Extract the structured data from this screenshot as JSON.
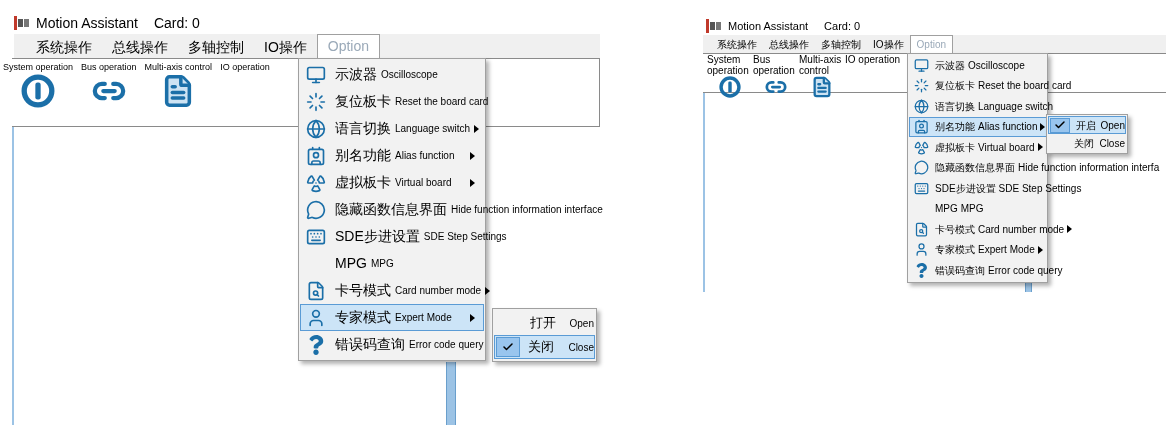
{
  "panels": [
    {
      "title": "Motion Assistant",
      "card": "Card: 0",
      "menubar": [
        {
          "label": "系统操作",
          "selected": false
        },
        {
          "label": "总线操作",
          "selected": false
        },
        {
          "label": "多轴控制",
          "selected": false
        },
        {
          "label": "IO操作",
          "selected": false
        },
        {
          "label": "Option",
          "selected": true
        }
      ],
      "toolbar": [
        {
          "label": "System operation"
        },
        {
          "label": "Bus operation"
        },
        {
          "label": "Multi-axis control"
        },
        {
          "label": "IO operation"
        }
      ],
      "menu": [
        {
          "zh": "示波器",
          "en": "Oscilloscope",
          "submenu": false,
          "selected": false
        },
        {
          "zh": "复位板卡",
          "en": "Reset the board card",
          "submenu": false,
          "selected": false
        },
        {
          "zh": "语言切换",
          "en": "Language switch",
          "submenu": true,
          "selected": false
        },
        {
          "zh": "别名功能",
          "en": "Alias function",
          "submenu": true,
          "selected": false
        },
        {
          "zh": "虚拟板卡",
          "en": "Virtual board",
          "submenu": true,
          "selected": false
        },
        {
          "zh": "隐藏函数信息界面",
          "en": "Hide function information interface",
          "submenu": false,
          "selected": false
        },
        {
          "zh": "SDE步进设置",
          "en": "SDE Step Settings",
          "submenu": false,
          "selected": false
        },
        {
          "zh": "MPG",
          "en": "MPG",
          "submenu": false,
          "selected": false
        },
        {
          "zh": "卡号模式",
          "en": "Card number mode",
          "submenu": true,
          "selected": false
        },
        {
          "zh": "专家模式",
          "en": "Expert Mode",
          "submenu": true,
          "selected": true
        },
        {
          "zh": "错误码查询",
          "en": "Error code query",
          "submenu": false,
          "selected": false
        }
      ],
      "submenu": [
        {
          "zh": "打开",
          "en": "Open",
          "checked": false,
          "selected": false
        },
        {
          "zh": "关闭",
          "en": "Close",
          "checked": true,
          "selected": true
        }
      ]
    },
    {
      "title": "Motion Assistant",
      "card": "Card: 0",
      "menubar": [
        {
          "label": "系统操作",
          "selected": false
        },
        {
          "label": "总线操作",
          "selected": false
        },
        {
          "label": "多轴控制",
          "selected": false
        },
        {
          "label": "IO操作",
          "selected": false
        },
        {
          "label": "Option",
          "selected": true
        }
      ],
      "toolbar": [
        {
          "label": "System operation"
        },
        {
          "label": "Bus operation"
        },
        {
          "label": "Multi-axis control"
        },
        {
          "label": "IO operation"
        }
      ],
      "menu": [
        {
          "zh": "示波器",
          "en": "Oscilloscope",
          "submenu": false,
          "selected": false
        },
        {
          "zh": "复位板卡",
          "en": "Reset the board card",
          "submenu": false,
          "selected": false
        },
        {
          "zh": "语言切换",
          "en": "Language switch",
          "submenu": false,
          "selected": false
        },
        {
          "zh": "别名功能",
          "en": "Alias function",
          "submenu": true,
          "selected": true
        },
        {
          "zh": "虚拟板卡",
          "en": "Virtual board",
          "submenu": true,
          "selected": false
        },
        {
          "zh": "隐藏函数信息界面",
          "en": "Hide function information interfa",
          "submenu": false,
          "selected": false
        },
        {
          "zh": "SDE步进设置",
          "en": "SDE Step Settings",
          "submenu": false,
          "selected": false
        },
        {
          "zh": "MPG",
          "en": "MPG",
          "submenu": false,
          "selected": false
        },
        {
          "zh": "卡号模式",
          "en": "Card number mode",
          "submenu": true,
          "selected": false
        },
        {
          "zh": "专家模式",
          "en": "Expert Mode",
          "submenu": true,
          "selected": false
        },
        {
          "zh": "错误码查询",
          "en": "Error code query",
          "submenu": false,
          "selected": false
        }
      ],
      "submenu": [
        {
          "zh": "开启",
          "en": "Open",
          "checked": true,
          "selected": true
        },
        {
          "zh": "关闭",
          "en": "Close",
          "checked": false,
          "selected": false
        }
      ]
    }
  ]
}
